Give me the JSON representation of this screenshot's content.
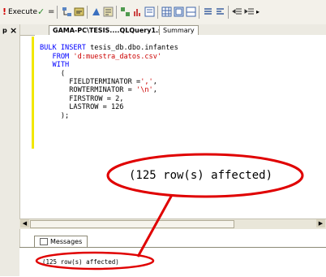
{
  "toolbar": {
    "execute_label": "Execute"
  },
  "tabs": {
    "query_tab": "GAMA-PC\\TESIS....QLQuery1.sql*",
    "summary_tab": "Summary"
  },
  "gutter": {
    "pin_glyph": "p",
    "close_glyph": "×"
  },
  "code": {
    "line1_kw": "BULK INSERT",
    "line1_obj": " tesis_db.dbo.infantes",
    "line2_kw": "FROM",
    "line2_str": "'d:muestra_datos.csv'",
    "line3_kw": "WITH",
    "line4": "(",
    "line5_a": "FIELDTERMINATOR =",
    "line5_b": "','",
    "line5_c": ",",
    "line6_a": "ROWTERMINATOR = ",
    "line6_b": "'\\n'",
    "line6_c": ",",
    "line7": "FIRSTROW = 2,",
    "line8": "LASTROW = 126",
    "line9": ");"
  },
  "messages": {
    "tab_label": "Messages",
    "result_text": "(125 row(s) affected)"
  },
  "callout": {
    "text": "(125 row(s) affected)"
  },
  "colors": {
    "keyword": "#0000ff",
    "string": "#cc0000",
    "annotation": "#e00000",
    "change_marker": "#f2e700"
  }
}
